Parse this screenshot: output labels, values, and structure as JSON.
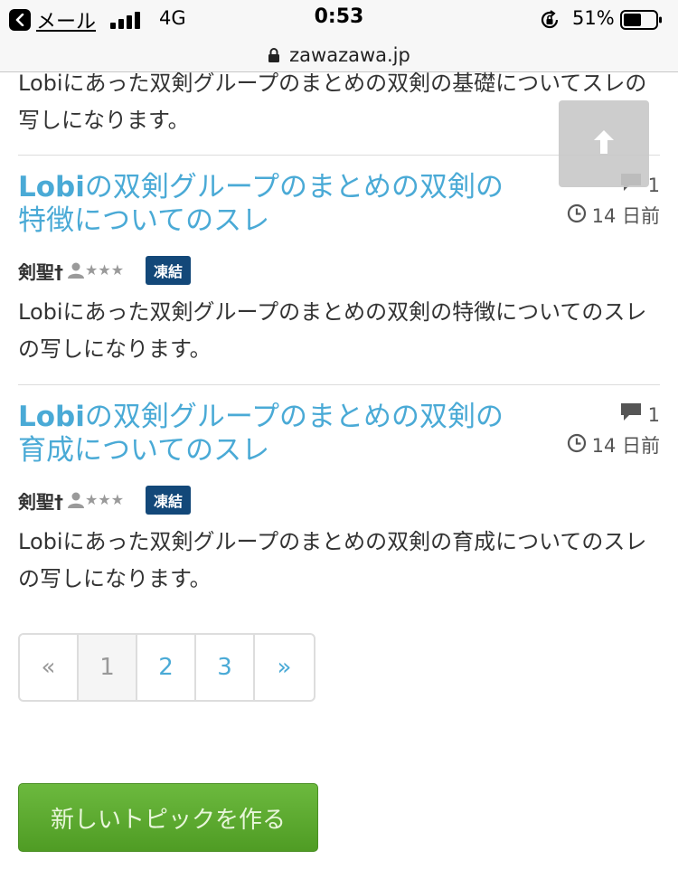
{
  "status_bar": {
    "back_label": "メール",
    "network": "4G",
    "time": "0:53",
    "battery": "51%"
  },
  "url_bar": {
    "url": "zawazawa.jp"
  },
  "top_description": "Lobiにあった双剣グループのまとめの双剣の基礎についてスレの写しになります。",
  "topics": [
    {
      "title_bold": "Lobi",
      "title_rest": "の双剣グループのまとめの双剣の特徴についてのスレ",
      "comments": "1",
      "date": "14 日前",
      "author": "剣聖†",
      "badge": "凍結",
      "description": "Lobiにあった双剣グループのまとめの双剣の特徴についてのスレの写しになります。"
    },
    {
      "title_bold": "Lobi",
      "title_rest": "の双剣グループのまとめの双剣の育成についてのスレ",
      "comments": "1",
      "date": "14 日前",
      "author": "剣聖†",
      "badge": "凍結",
      "description": "Lobiにあった双剣グループのまとめの双剣の育成についてのスレの写しになります。"
    }
  ],
  "pagination": {
    "prev": "«",
    "pages": [
      "1",
      "2",
      "3"
    ],
    "next": "»"
  },
  "new_topic_label": "新しいトピックを作る",
  "colors": {
    "link": "#4aaad6",
    "badge_bg": "#134879",
    "button_green": "#5aa82f"
  }
}
